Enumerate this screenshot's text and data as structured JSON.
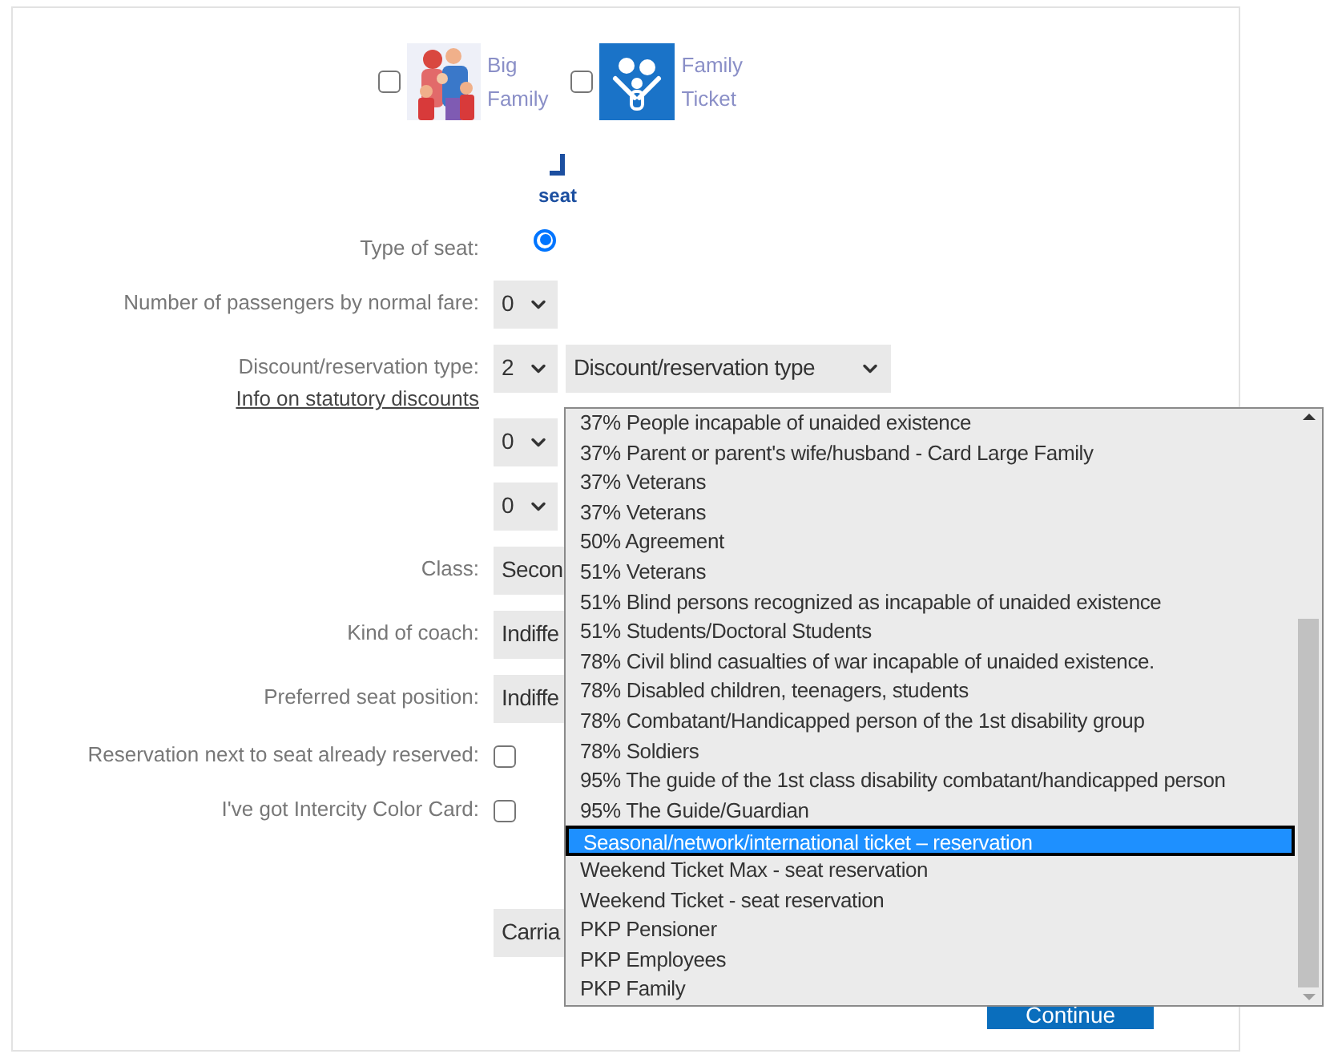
{
  "ticket_options": [
    {
      "kind": "picture",
      "label_lines": [
        "Big",
        "Family"
      ],
      "checked": false
    },
    {
      "kind": "icon",
      "label_lines": [
        "Family",
        "Ticket"
      ],
      "checked": false
    }
  ],
  "seat_type": {
    "caption": "seat",
    "label": "Type of seat:",
    "selected": true
  },
  "form_rows": [
    {
      "kind": "select",
      "label": "Number of passengers by normal fare:",
      "value": "0"
    },
    {
      "kind": "discount",
      "label": "Discount/reservation type:",
      "link": "Info on statutory discounts",
      "value": "2",
      "type_value": "Discount/reservation type"
    },
    {
      "kind": "select",
      "value": "0"
    },
    {
      "kind": "select",
      "value": "0"
    },
    {
      "kind": "select_cut",
      "label": "Class:",
      "value": "Secon"
    },
    {
      "kind": "select_cut",
      "label": "Kind of coach:",
      "value": "Indiffe"
    },
    {
      "kind": "select_cut",
      "label": "Preferred seat position:",
      "value": "Indiffe"
    },
    {
      "kind": "checkbox",
      "label": "Reservation next to seat already reserved:",
      "checked": false
    },
    {
      "kind": "checkbox",
      "label": "I've got Intercity Color Card:",
      "checked": false
    },
    {
      "kind": "select_cut",
      "value": "Carria"
    }
  ],
  "continue_button": "Continue",
  "dropdown": {
    "options": [
      {
        "label": "37% People incapable of unaided existence",
        "selected": false
      },
      {
        "label": "37% Parent or parent's wife/husband - Card Large Family",
        "selected": false
      },
      {
        "label": "37% Veterans",
        "selected": false
      },
      {
        "label": "37% Veterans",
        "selected": false
      },
      {
        "label": "50% Agreement",
        "selected": false
      },
      {
        "label": "51% Veterans",
        "selected": false
      },
      {
        "label": "51% Blind persons recognized as incapable of unaided existence",
        "selected": false
      },
      {
        "label": "51% Students/Doctoral Students",
        "selected": false
      },
      {
        "label": "78% Civil blind casualties of war incapable of unaided existence.",
        "selected": false
      },
      {
        "label": "78% Disabled children, teenagers, students",
        "selected": false
      },
      {
        "label": "78% Combatant/Handicapped person of the 1st disability group",
        "selected": false
      },
      {
        "label": "78% Soldiers",
        "selected": false
      },
      {
        "label": "95% The guide of the 1st class disability combatant/handicapped person",
        "selected": false
      },
      {
        "label": "95% The Guide/Guardian",
        "selected": false
      },
      {
        "label": "Seasonal/network/international ticket – reservation",
        "selected": true
      },
      {
        "label": "Weekend Ticket Max - seat reservation",
        "selected": false
      },
      {
        "label": "Weekend Ticket - seat reservation",
        "selected": false
      },
      {
        "label": "PKP Pensioner",
        "selected": false
      },
      {
        "label": "PKP Employees",
        "selected": false
      },
      {
        "label": "PKP Family",
        "selected": false
      }
    ]
  }
}
